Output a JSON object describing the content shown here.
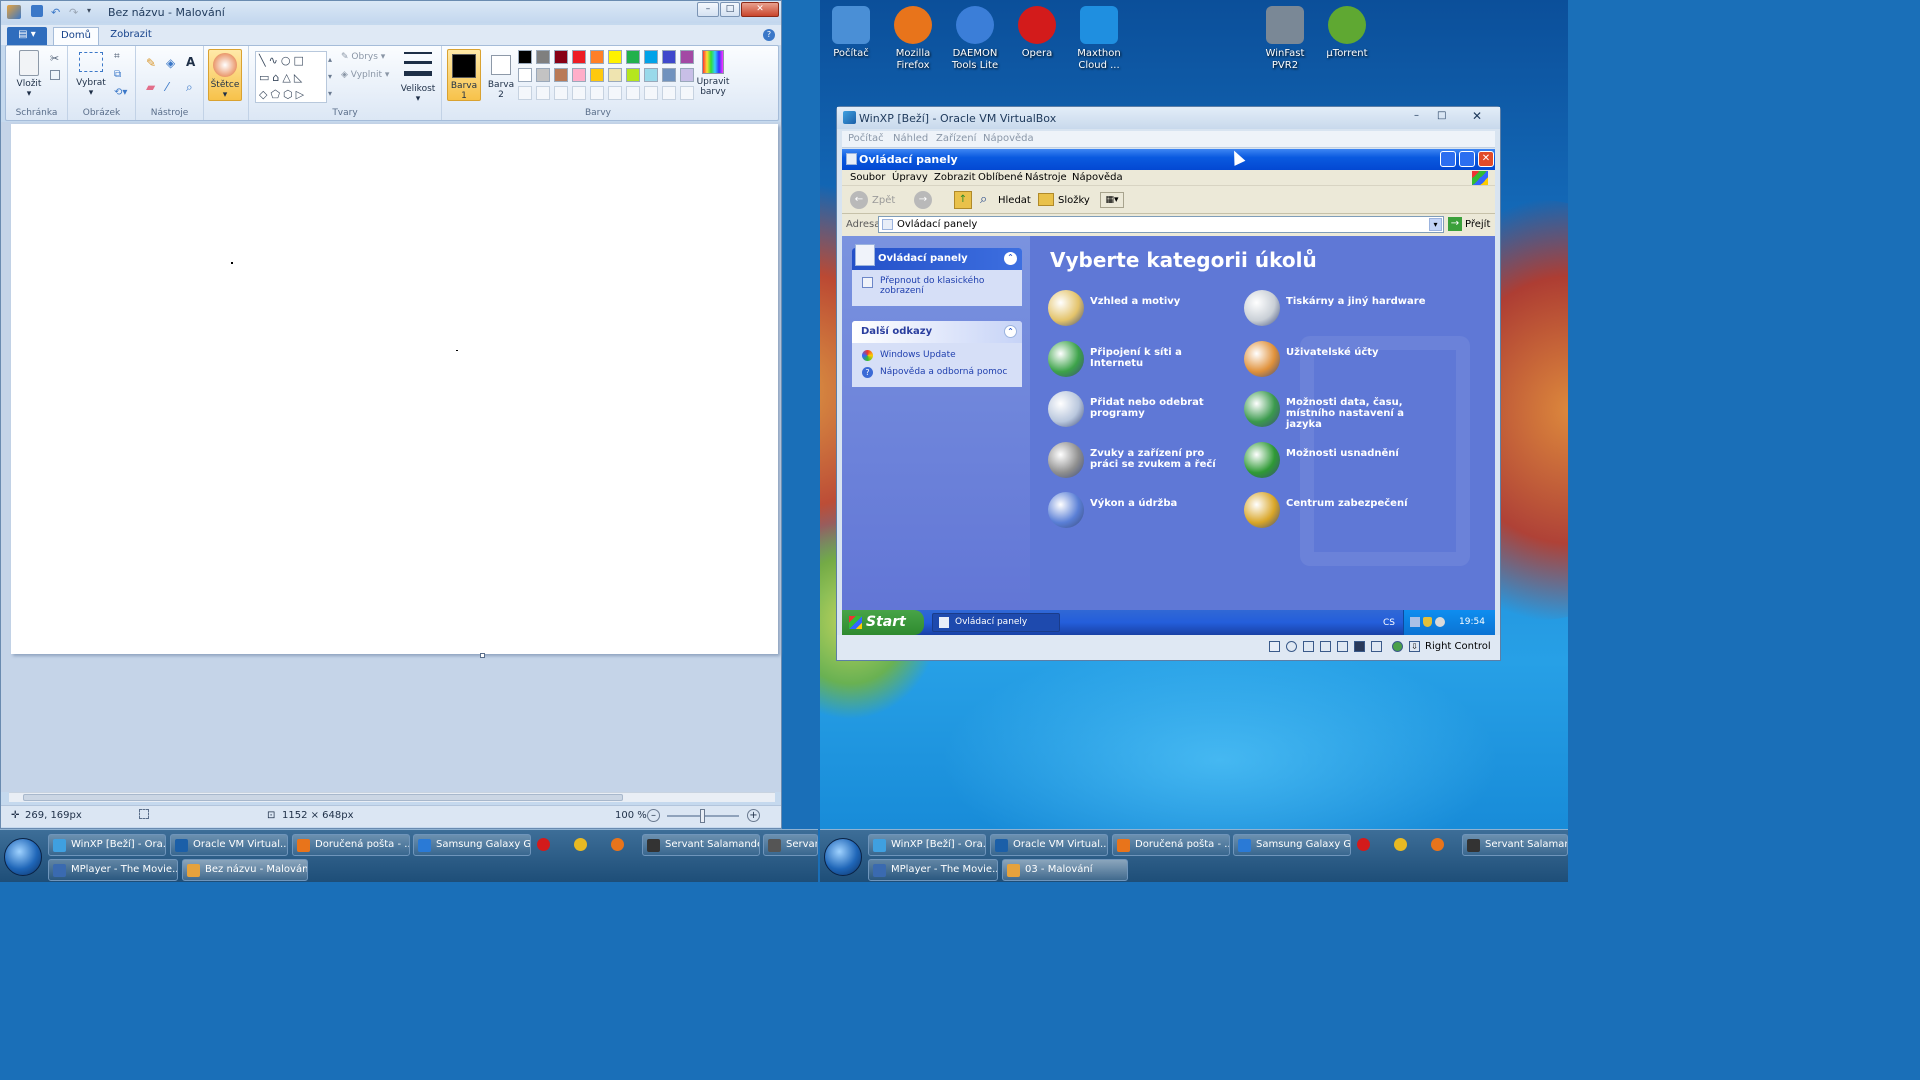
{
  "paint": {
    "title": "Bez názvu - Malování",
    "tabs": [
      "Domů",
      "Zobrazit"
    ],
    "groups": {
      "clipboard": {
        "label": "Schránka",
        "paste": "Vložit"
      },
      "image": {
        "label": "Obrázek",
        "select": "Vybrat"
      },
      "tools": {
        "label": "Nástroje"
      },
      "brushes": "Štětce",
      "shapes": {
        "label": "Tvary",
        "outline": "Obrys",
        "fill": "Vyplnit"
      },
      "size": "Velikost",
      "color1": "Barva 1",
      "color2": "Barva 2",
      "colors": {
        "label": "Barvy",
        "edit": "Upravit barvy"
      }
    },
    "palette": [
      "#000000",
      "#7f7f7f",
      "#880015",
      "#ed1c24",
      "#ff7f27",
      "#fff200",
      "#22b14c",
      "#00a2e8",
      "#3f48cc",
      "#a349a4",
      "#ffffff",
      "#c3c3c3",
      "#b97a57",
      "#ffaec9",
      "#ffc90e",
      "#efe4b0",
      "#b5e61d",
      "#99d9ea",
      "#7092be",
      "#c8bfe7"
    ],
    "status": {
      "cursor": "269, 169px",
      "size": "1152 × 648px",
      "zoom": "100 %"
    }
  },
  "desktop_icons": [
    {
      "label": "Počítač",
      "color": "#4a8fd6"
    },
    {
      "label": "Mozilla Firefox",
      "color": "#e8741b"
    },
    {
      "label": "DAEMON Tools Lite",
      "color": "#3b7ed8"
    },
    {
      "label": "Opera",
      "color": "#d31b1b"
    },
    {
      "label": "Maxthon Cloud ...",
      "color": "#1f8fe0"
    },
    {
      "label": "WinFast PVR2",
      "color": "#7a8896"
    },
    {
      "label": "µTorrent",
      "color": "#5fa832"
    }
  ],
  "vbox": {
    "title": "WinXP [Beží] - Oracle VM VirtualBox",
    "menu": [
      "Počítač",
      "Náhled",
      "Zařízení",
      "Nápověda"
    ],
    "host_key": "Right Control"
  },
  "xp": {
    "window_title": "Ovládací panely",
    "menu": [
      "Soubor",
      "Úpravy",
      "Zobrazit",
      "Oblíbené",
      "Nástroje",
      "Nápověda"
    ],
    "toolbar": {
      "back": "Zpět",
      "search": "Hledat",
      "folders": "Složky"
    },
    "address_label": "Adresa",
    "address_value": "Ovládací panely",
    "go": "Přejít",
    "left_panels": {
      "cp_title": "Ovládací panely",
      "cp_link": "Přepnout do klasického zobrazení",
      "more_title": "Další odkazy",
      "more_links": [
        "Windows Update",
        "Nápověda a odborná pomoc"
      ]
    },
    "heading": "Vyberte kategorii úkolů",
    "categories": [
      {
        "label": "Vzhled a motivy",
        "color": "#e3c36a"
      },
      {
        "label": "Tiskárny a jiný hardware",
        "color": "#c9cfd6"
      },
      {
        "label": "Připojení k síti a Internetu",
        "color": "#3da34a"
      },
      {
        "label": "Uživatelské účty",
        "color": "#e0913a"
      },
      {
        "label": "Přidat nebo odebrat programy",
        "color": "#b9c7dd"
      },
      {
        "label": "Možnosti data, času, místního nastavení a jazyka",
        "color": "#3b9a4d"
      },
      {
        "label": "Zvuky a zařízení pro práci se zvukem a řečí",
        "color": "#8f8f8f"
      },
      {
        "label": "Možnosti usnadnění",
        "color": "#2f9a35"
      },
      {
        "label": "Výkon a údržba",
        "color": "#5a7fd6"
      },
      {
        "label": "Centrum zabezpečení",
        "color": "#d9a628"
      }
    ],
    "start": "Start",
    "task": "Ovládací panely",
    "tray_lang": "CS",
    "clock": "19:54"
  },
  "taskbar_left": {
    "row1": [
      "WinXP [Beží] - Ora...",
      "Oracle VM Virtual...",
      "Doručená pošta - ...",
      "Samsung Galaxy G...",
      "Servant Salamander",
      "Servant S"
    ],
    "row2": [
      "MPlayer - The Movie...",
      "Bez názvu - Malování"
    ]
  },
  "taskbar_right": {
    "row1": [
      "WinXP [Beží] - Ora...",
      "Oracle VM Virtual...",
      "Doručená pošta - ...",
      "Samsung Galaxy G...",
      "Servant Salamander"
    ],
    "row2": [
      "MPlayer - The Movie...",
      "03 - Malování"
    ]
  }
}
